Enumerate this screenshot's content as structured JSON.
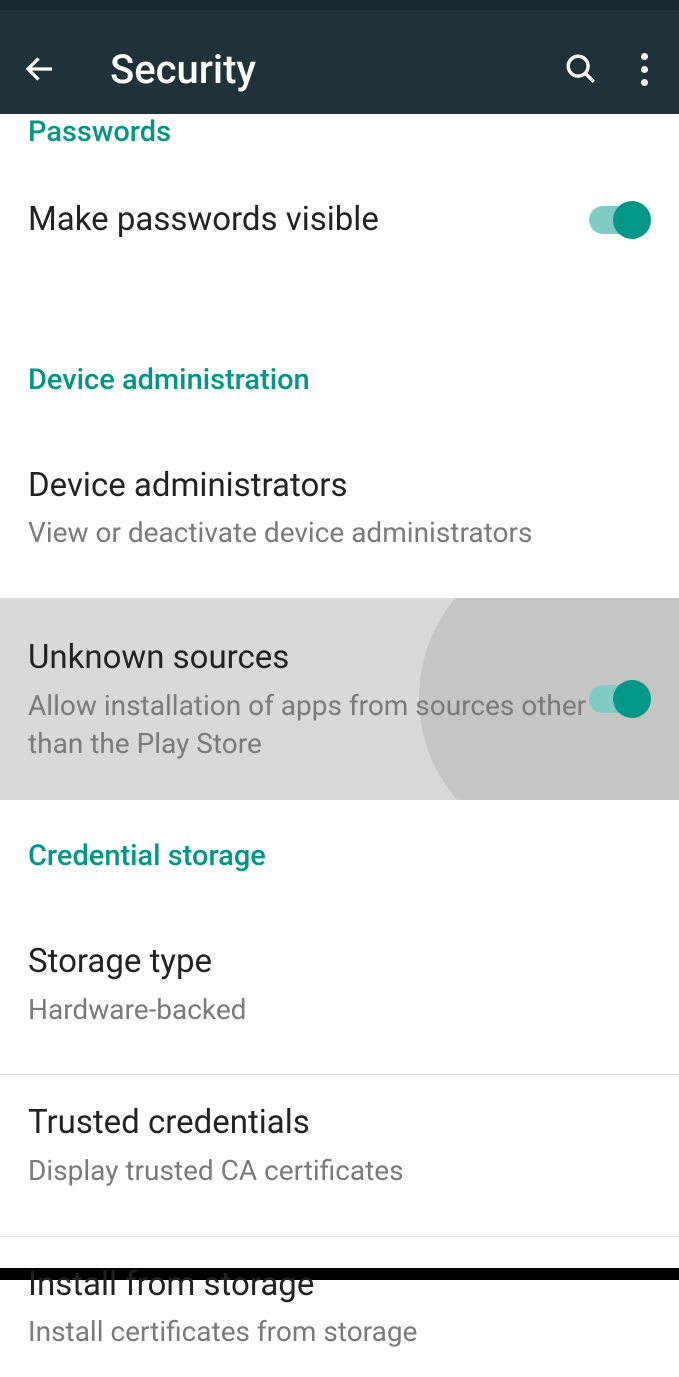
{
  "header": {
    "title": "Security"
  },
  "sections": {
    "passwords": {
      "header": "Passwords",
      "makeVisible": {
        "title": "Make passwords visible",
        "toggled": true
      }
    },
    "deviceAdmin": {
      "header": "Device administration",
      "administrators": {
        "title": "Device administrators",
        "subtitle": "View or deactivate device administrators"
      },
      "unknownSources": {
        "title": "Unknown sources",
        "subtitle": "Allow installation of apps from sources other than the Play Store",
        "toggled": true
      }
    },
    "credentialStorage": {
      "header": "Credential storage",
      "storageType": {
        "title": "Storage type",
        "subtitle": "Hardware-backed"
      },
      "trustedCredentials": {
        "title": "Trusted credentials",
        "subtitle": "Display trusted CA certificates"
      },
      "installFromStorage": {
        "title": "Install from storage",
        "subtitle": "Install certificates from storage"
      }
    }
  },
  "colors": {
    "accent": "#009688",
    "appBar": "#1f3239"
  }
}
